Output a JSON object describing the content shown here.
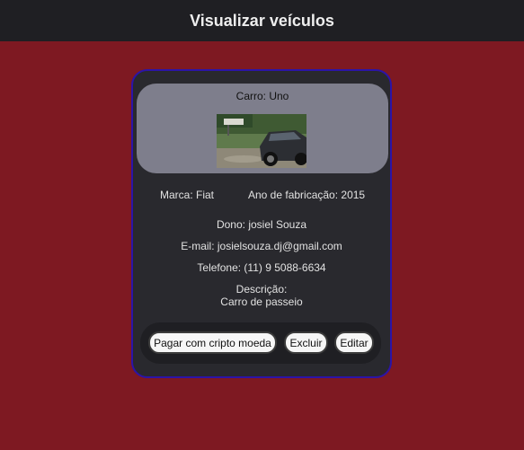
{
  "header": {
    "title": "Visualizar veículos"
  },
  "vehicle": {
    "title": "Carro: Uno",
    "image_alt": "car-photo",
    "brand": "Marca: Fiat",
    "year": "Ano de fabricação: 2015",
    "owner": "Dono: josiel Souza",
    "email": "E-mail: josielsouza.dj@gmail.com",
    "phone": "Telefone: (11) 9 5088-6634",
    "description_label": "Descrição:",
    "description": "Carro de passeio"
  },
  "actions": {
    "pay_label": "Pagar com cripto moeda",
    "delete_label": "Excluir",
    "edit_label": "Editar"
  },
  "colors": {
    "background": "#7e1922",
    "topbar": "#1f1f23",
    "card": "#29292e",
    "card_border": "#2c14a8",
    "image_panel": "#7e7e8c"
  }
}
